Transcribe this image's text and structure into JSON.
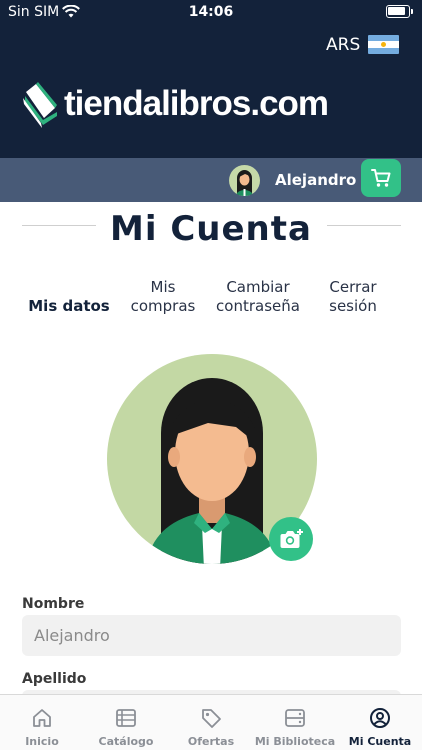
{
  "status_bar": {
    "carrier": "Sin SIM",
    "time": "14:06"
  },
  "header": {
    "currency": "ARS",
    "logo_text": "tiendalibros.com"
  },
  "user_bar": {
    "name": "Alejandro"
  },
  "page": {
    "title": "Mi Cuenta"
  },
  "tabs": [
    {
      "label": "Mis datos",
      "active": true
    },
    {
      "label": "Mis\ncompras",
      "active": false
    },
    {
      "label": "Cambiar\ncontraseña",
      "active": false
    },
    {
      "label": "Cerrar\nsesión",
      "active": false
    }
  ],
  "form": {
    "nombre_label": "Nombre",
    "nombre_value": "Alejandro",
    "apellido_label": "Apellido"
  },
  "tabbar": [
    {
      "label": "Inicio",
      "icon": "home-icon"
    },
    {
      "label": "Catálogo",
      "icon": "catalog-icon"
    },
    {
      "label": "Ofertas",
      "icon": "tag-icon"
    },
    {
      "label": "Mi Biblioteca",
      "icon": "library-icon"
    },
    {
      "label": "Mi Cuenta",
      "icon": "account-icon",
      "active": true
    }
  ],
  "colors": {
    "navy": "#13223a",
    "accent": "#32c188",
    "user_bar": "#485a77"
  }
}
